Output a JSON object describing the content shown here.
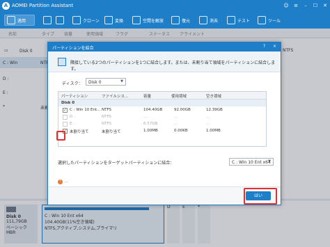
{
  "app": {
    "title": "AOMEI Partition Assistant",
    "brand_color": "#1e7fc8"
  },
  "toolbar": {
    "apply_label": "適用",
    "items": [
      {
        "label": "",
        "icon": "undo-icon"
      },
      {
        "label": "",
        "icon": "redo-icon"
      },
      {
        "label": "クローン",
        "icon": "clone-icon"
      },
      {
        "label": "変換",
        "icon": "convert-icon"
      },
      {
        "label": "空間を解放",
        "icon": "free-space-icon"
      },
      {
        "label": "復元",
        "icon": "recover-icon"
      },
      {
        "label": "消去",
        "icon": "wipe-icon"
      },
      {
        "label": "テスト",
        "icon": "test-icon"
      },
      {
        "label": "ツール",
        "icon": "tools-icon"
      }
    ]
  },
  "columns": [
    "名前",
    "タイプ",
    "容量",
    "使用領域",
    "フラグ",
    "ステータス",
    "アライメント"
  ],
  "left_rows": [
    {
      "name": "Disk 0"
    },
    {
      "name": "C : Win",
      "type": "NTFS"
    },
    {
      "name": "D :"
    },
    {
      "name": "E :"
    },
    {
      "name": "*",
      "type": "未割"
    }
  ],
  "right_fragment": "NTFS",
  "bottom": {
    "disk_name": "Disk 0",
    "disk_size": "111,79GB",
    "disk_type": "ベーシック MBR",
    "part_name": "C : Win 10 Ent x64",
    "part_size": "104.40GB(11%空き領域)",
    "part_info": "NTFS,アクティブ,システム,プライマリ",
    "mini": [
      "D",
      "E",
      "*"
    ]
  },
  "dialog": {
    "title": "パーティションを結合",
    "help": "?",
    "close": "×",
    "description": "隣接している2つのパーティションを1つに結合します。または、未割り当て領域をパーティションに結合します。",
    "disk_label": "ディスク：",
    "disk_value": "Disk 0",
    "table_headers": [
      "パーティション",
      "ファイルシス...",
      "容量",
      "使用領域",
      "空き領域"
    ],
    "group": "Disk 0",
    "rows": [
      {
        "checked": true,
        "name": "C : Win 10 Ent...",
        "fs": "NTFS",
        "cap": "104.40GB",
        "used": "92.00GB",
        "free": "12.39GB",
        "enabled": true
      },
      {
        "checked": false,
        "name": "D :",
        "fs": "NTFS",
        "cap": "...",
        "used": "...",
        "free": "...",
        "enabled": false
      },
      {
        "checked": false,
        "name": "E :",
        "fs": "NTFS",
        "cap": "6.57GB",
        "used": "...",
        "free": "...",
        "enabled": false
      },
      {
        "checked": true,
        "name": "未割り当て",
        "fs": "未割り当て",
        "cap": "1.00MB",
        "used": "0.00KB",
        "free": "1.00MB",
        "enabled": true
      }
    ],
    "merge_label": "選択したパーティションをターゲットパーティションに結合：",
    "target_value": "C : Win 10 Ent x64",
    "warning": "...",
    "ok_label": "はい"
  }
}
